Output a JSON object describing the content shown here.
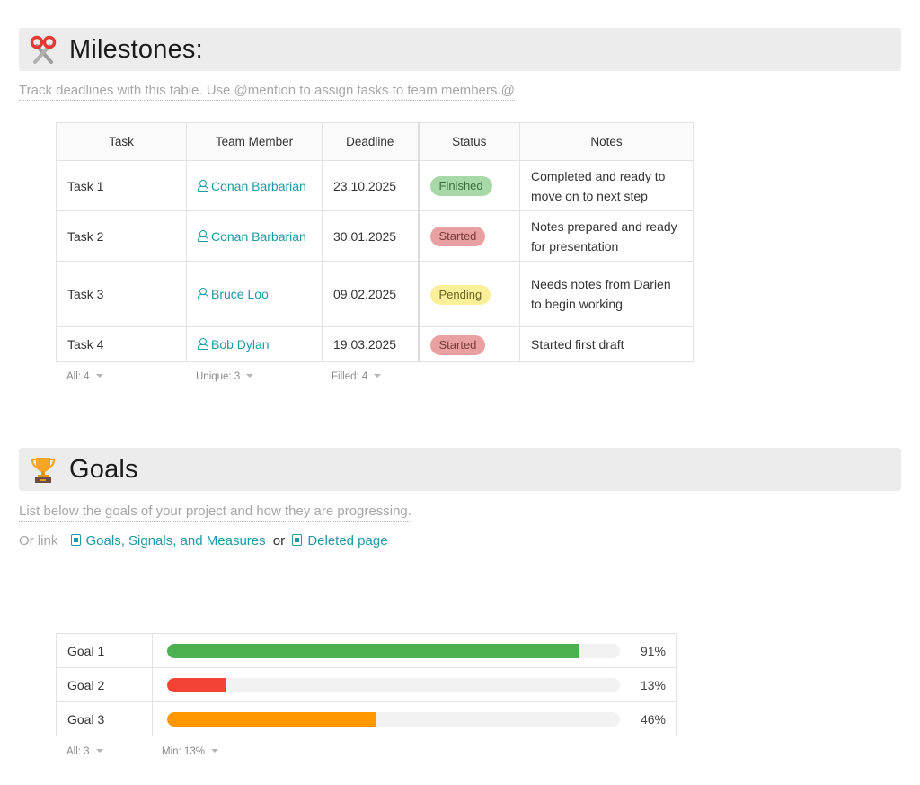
{
  "milestones": {
    "title": "Milestones:",
    "icon": "scissors-icon",
    "hint": "Track deadlines with this table. Use @mention to assign tasks to team members.@",
    "columns": [
      "Task",
      "Team Member",
      "Deadline",
      "Status",
      "Notes"
    ],
    "rows": [
      {
        "task": "Task 1",
        "member": "Conan Barbarian",
        "deadline": "23.10.2025",
        "status": "Finished",
        "notes": "Completed and ready to move on to next step"
      },
      {
        "task": "Task 2",
        "member": "Conan Barbarian",
        "deadline": "30.01.2025",
        "status": "Started",
        "notes": "Notes prepared and ready for presentation"
      },
      {
        "task": "Task 3",
        "member": "Bruce Loo",
        "deadline": "09.02.2025",
        "status": "Pending",
        "notes": "Needs notes from Darien to begin working"
      },
      {
        "task": "Task 4",
        "member": "Bob Dylan",
        "deadline": "19.03.2025",
        "status": "Started",
        "notes": "Started first draft"
      }
    ],
    "status_colors": {
      "Finished": {
        "bg": "#a8d8a8",
        "fg": "#3e6e3e"
      },
      "Started": {
        "bg": "#e8a0a0",
        "fg": "#7a3a3a"
      },
      "Pending": {
        "bg": "#fbf09a",
        "fg": "#6b6320"
      }
    },
    "footer": {
      "task": "All: 4",
      "member": "Unique: 3",
      "deadline": "Filled: 4"
    }
  },
  "goals": {
    "title": "Goals",
    "icon": "trophy-icon",
    "hint": "List below the goals of your project and how they are progressing.",
    "or_link_label": "Or link",
    "links": [
      "Goals, Signals, and Measures",
      "Deleted page"
    ],
    "link_separator": "or",
    "items": [
      {
        "name": "Goal 1",
        "percent": 91,
        "label": "91%",
        "color": "#4caf50"
      },
      {
        "name": "Goal 2",
        "percent": 13,
        "label": "13%",
        "color": "#f44336"
      },
      {
        "name": "Goal 3",
        "percent": 46,
        "label": "46%",
        "color": "#ff9800"
      }
    ],
    "footer": {
      "name": "All: 3",
      "bar": "Min: 13%"
    }
  },
  "colors": {
    "accent": "#1b9aa6",
    "header_bg": "#ececec"
  }
}
